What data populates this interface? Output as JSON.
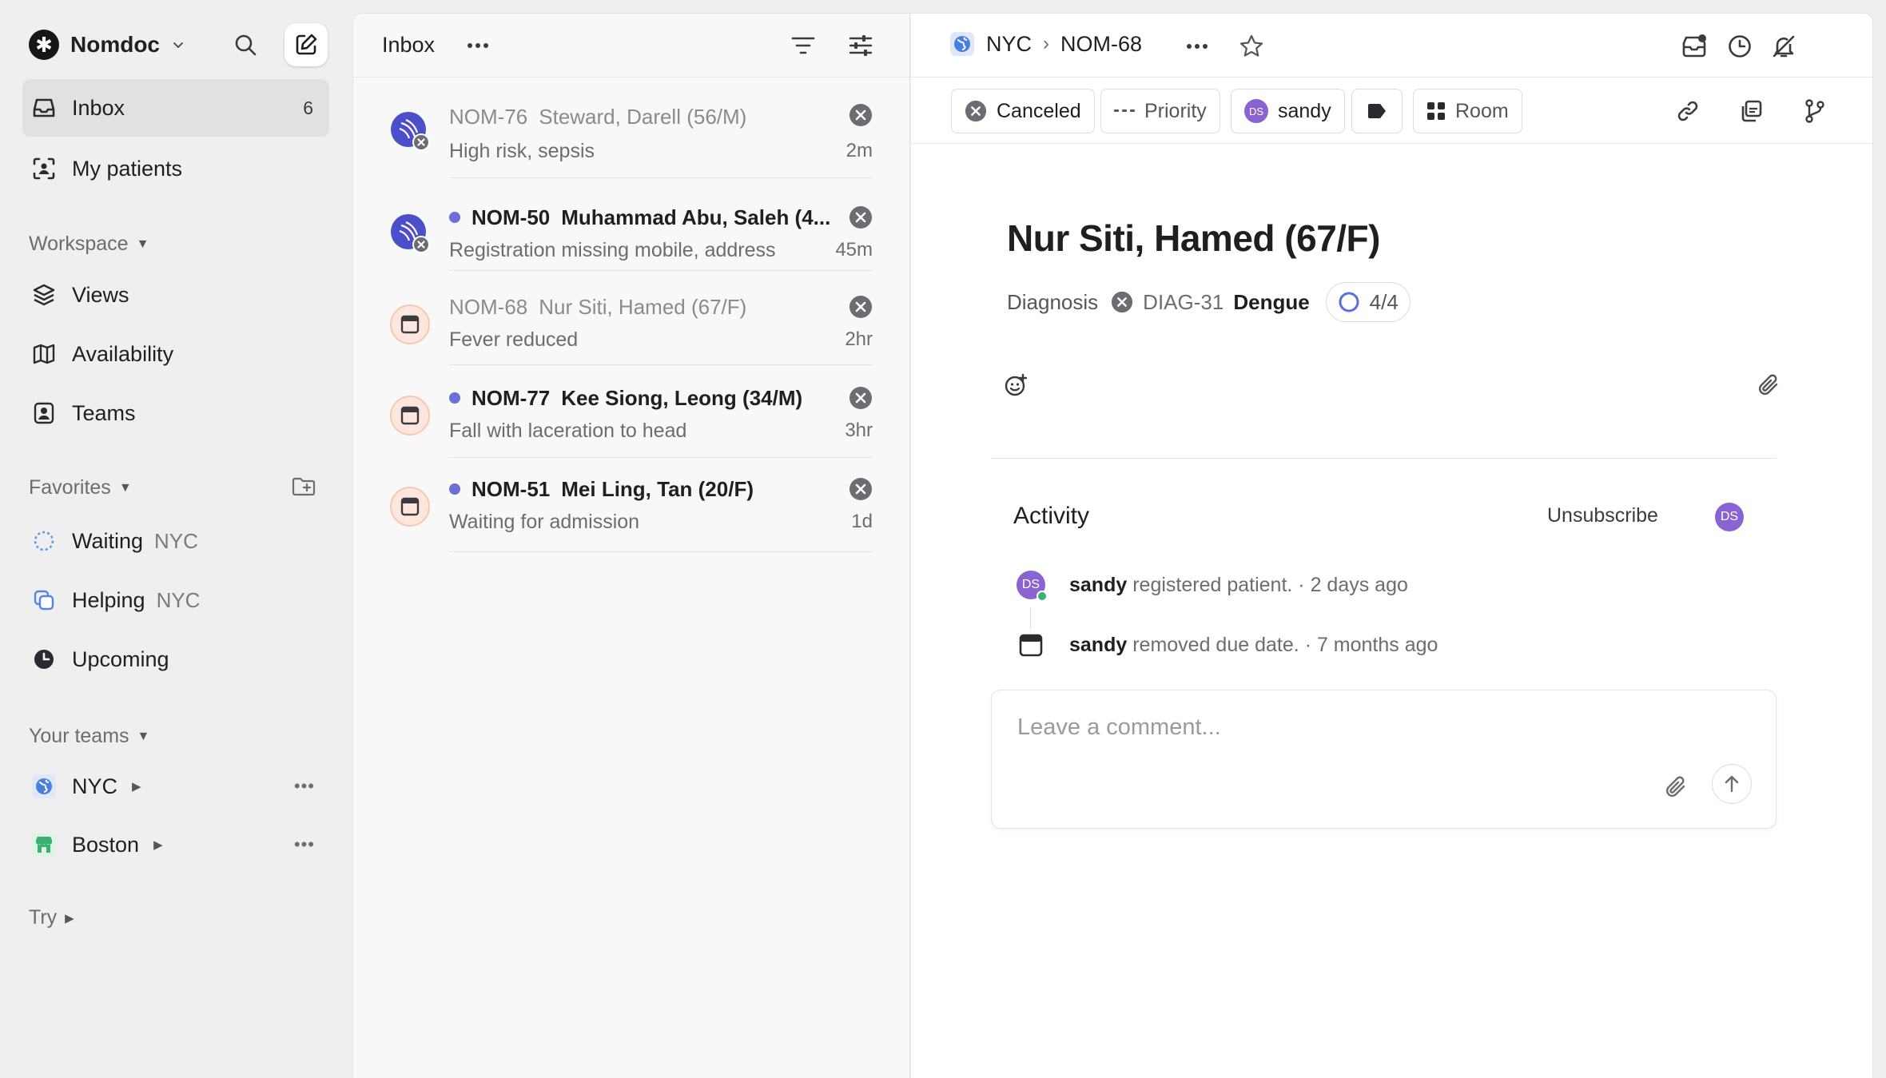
{
  "workspace": {
    "name": "Nomdoc",
    "logo_glyph": "✱"
  },
  "sidebar": {
    "inbox": {
      "label": "Inbox",
      "count": "6"
    },
    "my_patients": {
      "label": "My patients"
    },
    "workspace_section": "Workspace",
    "workspace_items": [
      {
        "label": "Views",
        "icon": "layers-icon"
      },
      {
        "label": "Availability",
        "icon": "map-icon"
      },
      {
        "label": "Teams",
        "icon": "contact-icon"
      }
    ],
    "favorites_section": "Favorites",
    "favorites": [
      {
        "label": "Waiting",
        "team": "NYC",
        "icon": "dashed-circle-icon"
      },
      {
        "label": "Helping",
        "team": "NYC",
        "icon": "squares-icon"
      },
      {
        "label": "Upcoming",
        "team": "",
        "icon": "clock-fill-icon"
      }
    ],
    "teams_section": "Your teams",
    "teams": [
      {
        "label": "NYC",
        "icon": "globe-icon"
      },
      {
        "label": "Boston",
        "icon": "store-icon"
      }
    ],
    "try_section": "Try"
  },
  "inbox": {
    "title": "Inbox",
    "items": [
      {
        "id": "NOM-76",
        "name": "Steward, Darell (56/M)",
        "note": "High risk, sepsis",
        "time": "2m",
        "unread": false
      },
      {
        "id": "NOM-50",
        "name": "Muhammad Abu, Saleh (4...",
        "note": "Registration missing mobile, address",
        "time": "45m",
        "unread": true
      },
      {
        "id": "NOM-68",
        "name": "Nur Siti, Hamed (67/F)",
        "note": "Fever reduced",
        "time": "2hr",
        "unread": false
      },
      {
        "id": "NOM-77",
        "name": "Kee Siong, Leong (34/M)",
        "note": "Fall with laceration to head",
        "time": "3hr",
        "unread": true
      },
      {
        "id": "NOM-51",
        "name": "Mei Ling, Tan (20/F)",
        "note": "Waiting for admission",
        "time": "1d",
        "unread": true
      }
    ]
  },
  "detail": {
    "breadcrumb": {
      "team": "NYC",
      "issue": "NOM-68"
    },
    "toolbar": {
      "status": "Canceled",
      "priority": "Priority",
      "assignee": "sandy",
      "assignee_initials": "DS",
      "room": "Room"
    },
    "title": "Nur Siti, Hamed (67/F)",
    "diagnosis": {
      "label": "Diagnosis",
      "id": "DIAG-31",
      "name": "Dengue",
      "progress": "4/4"
    },
    "activity": {
      "title": "Activity",
      "unsubscribe": "Unsubscribe",
      "subscriber_initials": "DS",
      "events": [
        {
          "who": "sandy",
          "what": "registered patient.",
          "sep": "·",
          "when": "2 days ago"
        },
        {
          "who": "sandy",
          "what": "removed due date.",
          "sep": "·",
          "when": "7 months ago"
        }
      ]
    },
    "comment": {
      "placeholder": "Leave a comment..."
    }
  },
  "colors": {
    "accent": "#6b6fd8",
    "avatar": "#8a63d2",
    "boston": "#3bb273",
    "nyc": "#4a7fe0",
    "online": "#3bb273"
  }
}
